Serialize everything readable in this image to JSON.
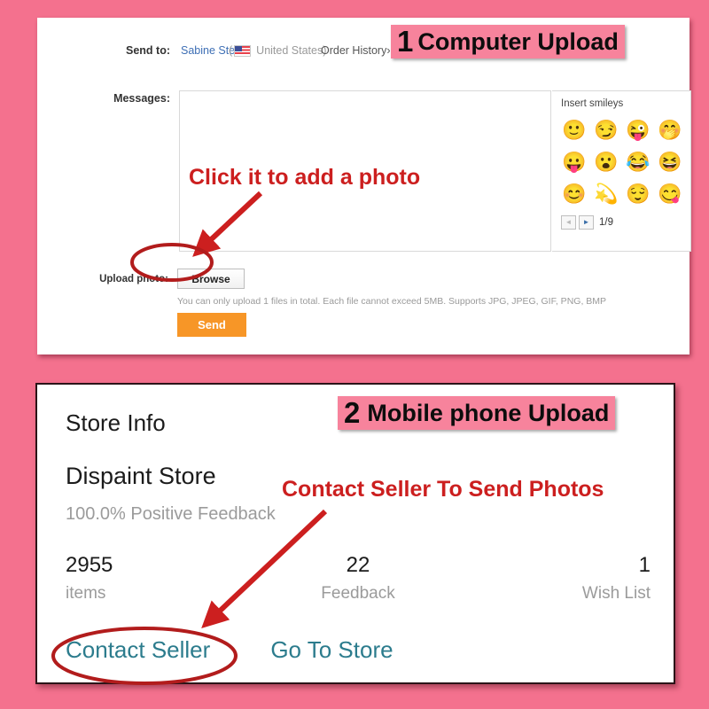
{
  "theme": {
    "background_pink": "#F4718E",
    "tag_pink": "#F7839C",
    "annotation_red": "#CC1F1F",
    "link_blue": "#3E6FB5",
    "link_teal": "#2C7C8D",
    "send_orange": "#F79627"
  },
  "panel1": {
    "tag": {
      "number": "1",
      "label": "Computer Upload"
    },
    "send_to": {
      "label": "Send to:",
      "recipient": "Sabine Steer",
      "country_open": "(",
      "country": "United States)",
      "flag_icon": "us-flag-icon",
      "order_history": "Order History",
      "order_history_chevron": "›"
    },
    "messages": {
      "label": "Messages:",
      "value": "",
      "placeholder": ""
    },
    "smileys": {
      "title": "Insert smileys",
      "items": [
        "🙂",
        "😏",
        "😜",
        "🤭",
        "😛",
        "😮",
        "😂",
        "😆",
        "😊",
        "💫",
        "😌",
        "😋"
      ],
      "prev_label": "◄",
      "next_label": "►",
      "page_indicator": "1/9"
    },
    "upload": {
      "label": "Upload photo:",
      "browse_label": "Browse",
      "note": "You can only upload 1 files in total. Each file cannot exceed 5MB. Supports JPG, JPEG, GIF, PNG, BMP",
      "send_label": "Send"
    },
    "annotation": "Click it to add a photo"
  },
  "panel2": {
    "tag": {
      "number": "2",
      "label": "Mobile phone Upload"
    },
    "title": "Store Info",
    "store_name": "Dispaint Store",
    "feedback": "100.0% Positive Feedback",
    "stats": [
      {
        "value": "2955",
        "label": "items"
      },
      {
        "value": "22",
        "label": "Feedback"
      },
      {
        "value": "1",
        "label": "Wish List"
      }
    ],
    "links": [
      {
        "label": "Contact Seller"
      },
      {
        "label": "Go To Store"
      }
    ],
    "annotation": "Contact Seller To Send Photos"
  }
}
